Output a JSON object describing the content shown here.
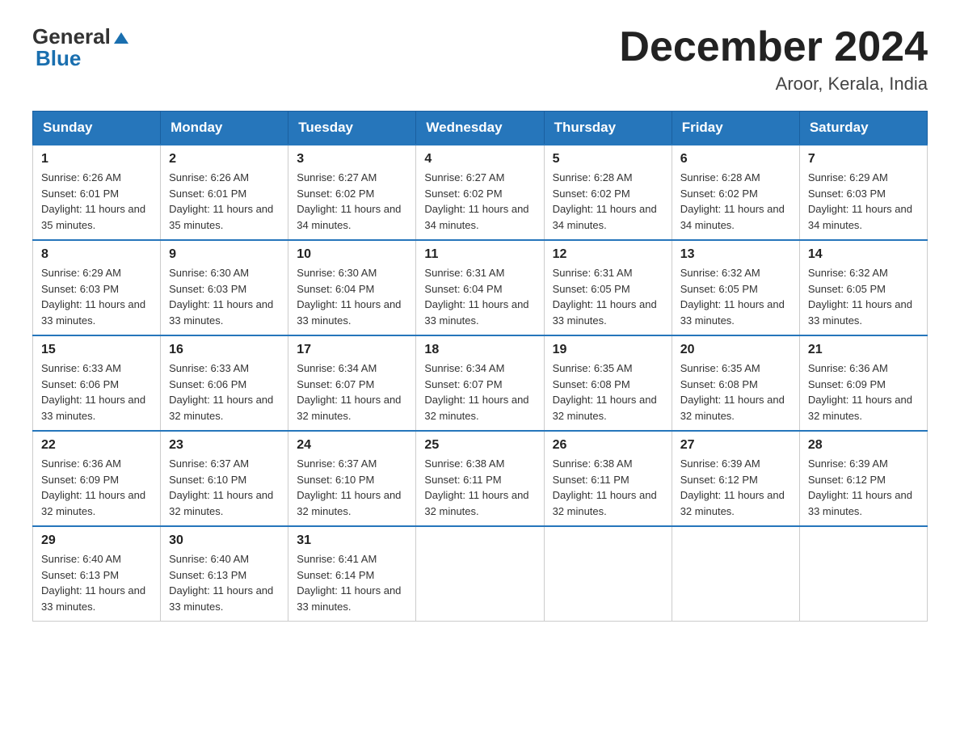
{
  "header": {
    "logo_text": "General",
    "logo_blue": "Blue",
    "month_title": "December 2024",
    "location": "Aroor, Kerala, India"
  },
  "days_of_week": [
    "Sunday",
    "Monday",
    "Tuesday",
    "Wednesday",
    "Thursday",
    "Friday",
    "Saturday"
  ],
  "weeks": [
    [
      {
        "day": "1",
        "sunrise": "6:26 AM",
        "sunset": "6:01 PM",
        "daylight": "11 hours and 35 minutes."
      },
      {
        "day": "2",
        "sunrise": "6:26 AM",
        "sunset": "6:01 PM",
        "daylight": "11 hours and 35 minutes."
      },
      {
        "day": "3",
        "sunrise": "6:27 AM",
        "sunset": "6:02 PM",
        "daylight": "11 hours and 34 minutes."
      },
      {
        "day": "4",
        "sunrise": "6:27 AM",
        "sunset": "6:02 PM",
        "daylight": "11 hours and 34 minutes."
      },
      {
        "day": "5",
        "sunrise": "6:28 AM",
        "sunset": "6:02 PM",
        "daylight": "11 hours and 34 minutes."
      },
      {
        "day": "6",
        "sunrise": "6:28 AM",
        "sunset": "6:02 PM",
        "daylight": "11 hours and 34 minutes."
      },
      {
        "day": "7",
        "sunrise": "6:29 AM",
        "sunset": "6:03 PM",
        "daylight": "11 hours and 34 minutes."
      }
    ],
    [
      {
        "day": "8",
        "sunrise": "6:29 AM",
        "sunset": "6:03 PM",
        "daylight": "11 hours and 33 minutes."
      },
      {
        "day": "9",
        "sunrise": "6:30 AM",
        "sunset": "6:03 PM",
        "daylight": "11 hours and 33 minutes."
      },
      {
        "day": "10",
        "sunrise": "6:30 AM",
        "sunset": "6:04 PM",
        "daylight": "11 hours and 33 minutes."
      },
      {
        "day": "11",
        "sunrise": "6:31 AM",
        "sunset": "6:04 PM",
        "daylight": "11 hours and 33 minutes."
      },
      {
        "day": "12",
        "sunrise": "6:31 AM",
        "sunset": "6:05 PM",
        "daylight": "11 hours and 33 minutes."
      },
      {
        "day": "13",
        "sunrise": "6:32 AM",
        "sunset": "6:05 PM",
        "daylight": "11 hours and 33 minutes."
      },
      {
        "day": "14",
        "sunrise": "6:32 AM",
        "sunset": "6:05 PM",
        "daylight": "11 hours and 33 minutes."
      }
    ],
    [
      {
        "day": "15",
        "sunrise": "6:33 AM",
        "sunset": "6:06 PM",
        "daylight": "11 hours and 33 minutes."
      },
      {
        "day": "16",
        "sunrise": "6:33 AM",
        "sunset": "6:06 PM",
        "daylight": "11 hours and 32 minutes."
      },
      {
        "day": "17",
        "sunrise": "6:34 AM",
        "sunset": "6:07 PM",
        "daylight": "11 hours and 32 minutes."
      },
      {
        "day": "18",
        "sunrise": "6:34 AM",
        "sunset": "6:07 PM",
        "daylight": "11 hours and 32 minutes."
      },
      {
        "day": "19",
        "sunrise": "6:35 AM",
        "sunset": "6:08 PM",
        "daylight": "11 hours and 32 minutes."
      },
      {
        "day": "20",
        "sunrise": "6:35 AM",
        "sunset": "6:08 PM",
        "daylight": "11 hours and 32 minutes."
      },
      {
        "day": "21",
        "sunrise": "6:36 AM",
        "sunset": "6:09 PM",
        "daylight": "11 hours and 32 minutes."
      }
    ],
    [
      {
        "day": "22",
        "sunrise": "6:36 AM",
        "sunset": "6:09 PM",
        "daylight": "11 hours and 32 minutes."
      },
      {
        "day": "23",
        "sunrise": "6:37 AM",
        "sunset": "6:10 PM",
        "daylight": "11 hours and 32 minutes."
      },
      {
        "day": "24",
        "sunrise": "6:37 AM",
        "sunset": "6:10 PM",
        "daylight": "11 hours and 32 minutes."
      },
      {
        "day": "25",
        "sunrise": "6:38 AM",
        "sunset": "6:11 PM",
        "daylight": "11 hours and 32 minutes."
      },
      {
        "day": "26",
        "sunrise": "6:38 AM",
        "sunset": "6:11 PM",
        "daylight": "11 hours and 32 minutes."
      },
      {
        "day": "27",
        "sunrise": "6:39 AM",
        "sunset": "6:12 PM",
        "daylight": "11 hours and 32 minutes."
      },
      {
        "day": "28",
        "sunrise": "6:39 AM",
        "sunset": "6:12 PM",
        "daylight": "11 hours and 33 minutes."
      }
    ],
    [
      {
        "day": "29",
        "sunrise": "6:40 AM",
        "sunset": "6:13 PM",
        "daylight": "11 hours and 33 minutes."
      },
      {
        "day": "30",
        "sunrise": "6:40 AM",
        "sunset": "6:13 PM",
        "daylight": "11 hours and 33 minutes."
      },
      {
        "day": "31",
        "sunrise": "6:41 AM",
        "sunset": "6:14 PM",
        "daylight": "11 hours and 33 minutes."
      },
      null,
      null,
      null,
      null
    ]
  ]
}
